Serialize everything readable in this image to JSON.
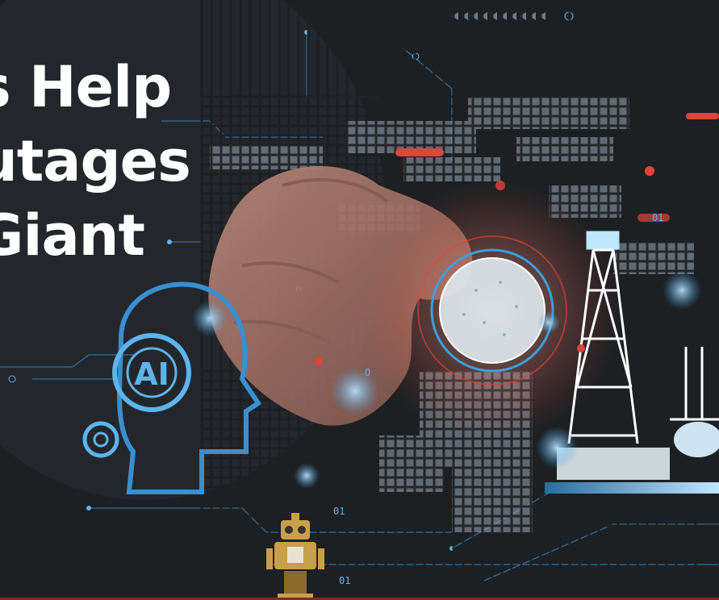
{
  "headline": {
    "lines": [
      "s Help",
      "utages",
      "Giant"
    ]
  },
  "graphics": {
    "ai_label": "AI",
    "hud_labels": [
      "01",
      "01",
      "01",
      "O"
    ],
    "colors": {
      "background": "#1d2023",
      "accent_blue": "#3aa0e0",
      "accent_red": "#e0453a",
      "text": "#ffffff"
    }
  }
}
